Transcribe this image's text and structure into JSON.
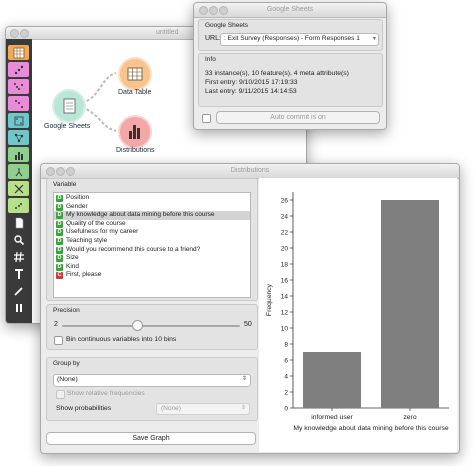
{
  "canvas_window": {
    "title": "untitled",
    "toolbar_icons": [
      "grid-icon",
      "scatter-icon",
      "scatter-dots-icon",
      "dots-icon",
      "matrix-icon",
      "network-icon",
      "bars-icon",
      "tree-icon",
      "cluster-icon",
      "scatter-green-icon",
      "document-icon",
      "magnifier-icon",
      "hash-icon",
      "text-icon",
      "pen-icon",
      "pause-icon"
    ],
    "widgets": {
      "google_sheets": "Google Sheets",
      "data_table": "Data Table",
      "distributions": "Distributions"
    }
  },
  "google_sheets_window": {
    "title": "Google Sheets",
    "section_label": "Google Sheets",
    "url_label": "URL:",
    "url_value": ": Exit Survey (Responses) - Form Responses 1",
    "info_label": "Info",
    "info_lines": [
      "33 instance(s), 10 feature(s), 4 meta attribute(s)",
      "First entry: 9/10/2015 17:19:33",
      "Last entry: 9/11/2015 14:14:53"
    ],
    "auto_commit": "Auto commit is on"
  },
  "distributions_window": {
    "title": "Distributions",
    "variable_label": "Variable",
    "variables": [
      {
        "tag": "D",
        "name": "Position",
        "color": "#3ba33b"
      },
      {
        "tag": "D",
        "name": "Gender",
        "color": "#3ba33b"
      },
      {
        "tag": "D",
        "name": "My knowledge about data mining before this course",
        "color": "#3ba33b"
      },
      {
        "tag": "D",
        "name": "Quality of the course",
        "color": "#3ba33b"
      },
      {
        "tag": "D",
        "name": "Usefulness for my career",
        "color": "#3ba33b"
      },
      {
        "tag": "D",
        "name": "Teaching style",
        "color": "#3ba33b"
      },
      {
        "tag": "D",
        "name": "Would you recommend this course to a friend?",
        "color": "#3ba33b"
      },
      {
        "tag": "D",
        "name": "Size",
        "color": "#3ba33b"
      },
      {
        "tag": "D",
        "name": "Kind",
        "color": "#3ba33b"
      },
      {
        "tag": "C",
        "name": "First, please",
        "color": "#d23a3a"
      }
    ],
    "selected_variable_index": 2,
    "precision_label": "Precision",
    "precision_min": "2",
    "precision_max": "50",
    "precision_value_fraction": 0.42,
    "bin_label": "Bin continuous variables into 10 bins",
    "group_by_label": "Group by",
    "group_by_value": "(None)",
    "relative_freq_label": "Show relative frequencies",
    "show_prob_label": "Show probabilities",
    "show_prob_value": "(None)",
    "save_graph": "Save Graph"
  },
  "chart_data": {
    "type": "bar",
    "categories": [
      "informed user",
      "zero"
    ],
    "values": [
      7,
      26
    ],
    "xlabel": "My knowledge about data mining before this course",
    "ylabel": "Frequency",
    "ylim": [
      0,
      27
    ],
    "yticks": [
      "0",
      "2",
      "4",
      "6",
      "8",
      "10",
      "12",
      "14",
      "16",
      "18",
      "20",
      "22",
      "24",
      "26"
    ],
    "bar_color": "#7f7f7f",
    "grid": false
  }
}
